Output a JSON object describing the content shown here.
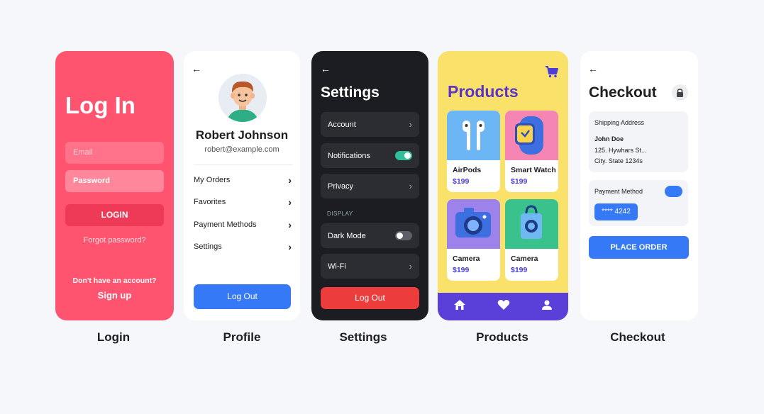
{
  "colors": {
    "login_bg": "#ff5470",
    "primary_blue": "#3579f6",
    "settings_bg": "#1c1d22",
    "products_bg": "#fae26a",
    "products_accent": "#5a34c7",
    "toggle_on": "#2fbf9a",
    "danger": "#ec3c3c"
  },
  "captions": {
    "login": "Login",
    "profile": "Profile",
    "settings": "Settings",
    "products": "Products",
    "checkout": "Checkout"
  },
  "login": {
    "title": "Log In",
    "email_placeholder": "Email",
    "password_placeholder": "Password",
    "login_button": "LOGIN",
    "forgot_link": "Forgot password?",
    "no_account_text": "Don't have an account?",
    "signup_link": "Sign up"
  },
  "profile": {
    "back_icon": "arrow-left-icon",
    "name": "Robert Johnson",
    "email": "robert@example.com",
    "menu": [
      {
        "label": "My Orders"
      },
      {
        "label": "Favorites"
      },
      {
        "label": "Payment Methods"
      },
      {
        "label": "Settings"
      }
    ],
    "logout_button": "Log Out"
  },
  "settings": {
    "title": "Settings",
    "rows": [
      {
        "label": "Account"
      },
      {
        "label": "Notifications",
        "toggle_on": true
      },
      {
        "label": "Privacy"
      }
    ],
    "section_label": "DISPLAY",
    "display_rows": [
      {
        "label": "Dark Mode",
        "toggle_on": false
      },
      {
        "label": "Wi-Fi"
      }
    ],
    "logout_button": "Log Out"
  },
  "products": {
    "title": "Products",
    "cart_icon": "shopping-cart-icon",
    "items": [
      {
        "name": "AirPods",
        "price": "$199",
        "icon": "airpods-icon"
      },
      {
        "name": "Smart Watch",
        "price": "$199",
        "icon": "smartwatch-icon"
      },
      {
        "name": "Camera",
        "price": "$199",
        "icon": "camera-icon"
      },
      {
        "name": "Camera",
        "price": "$199",
        "icon": "shopping-bag-icon"
      }
    ],
    "nav_icons": [
      "home-icon",
      "heart-icon",
      "user-icon"
    ]
  },
  "checkout": {
    "title": "Checkout",
    "lock_icon": "lock-icon",
    "shipping_label": "Shipping Address",
    "address": {
      "name": "John Doe",
      "line1": "125. Hywhars St...",
      "line2": "City. State 1234s"
    },
    "payment_label": "Payment Method",
    "card_number": "**** 4242",
    "place_order_button": "PLACE ORDER"
  }
}
